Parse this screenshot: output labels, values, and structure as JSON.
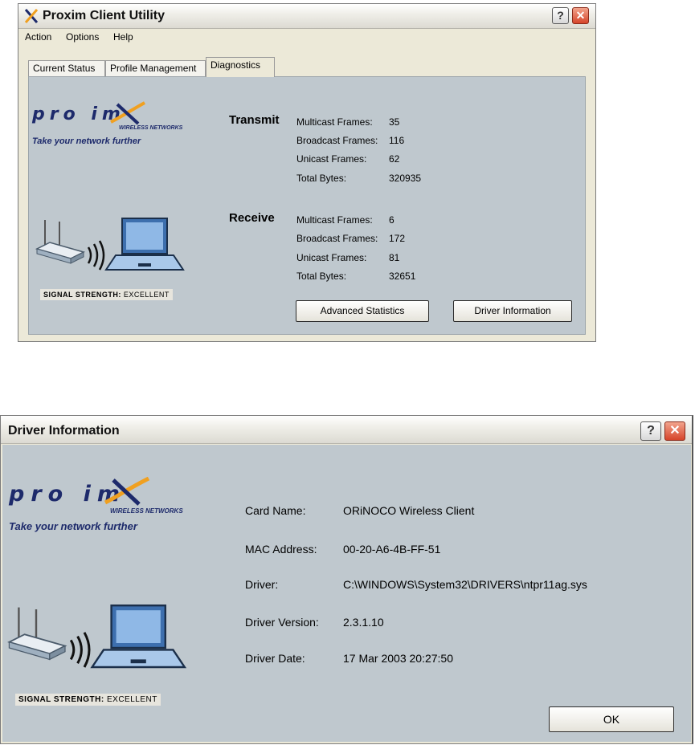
{
  "window1": {
    "title": "Proxim Client Utility",
    "help_button": "?",
    "close_button": "✕",
    "menus": [
      "Action",
      "Options",
      "Help"
    ],
    "tabs": [
      "Current Status",
      "Profile Management",
      "Diagnostics"
    ],
    "active_tab": "Diagnostics",
    "logo": {
      "word": "pro im",
      "sub": "WIRELESS NETWORKS",
      "tagline": "Take your network further"
    },
    "signal": {
      "label": "SIGNAL STRENGTH:",
      "value": "EXCELLENT"
    },
    "transmit": {
      "heading": "Transmit",
      "rows": [
        {
          "label": "Multicast Frames:",
          "value": "35"
        },
        {
          "label": "Broadcast Frames:",
          "value": "116"
        },
        {
          "label": "Unicast Frames:",
          "value": "62"
        },
        {
          "label": "Total Bytes:",
          "value": "320935"
        }
      ]
    },
    "receive": {
      "heading": "Receive",
      "rows": [
        {
          "label": "Multicast Frames:",
          "value": "6"
        },
        {
          "label": "Broadcast Frames:",
          "value": "172"
        },
        {
          "label": "Unicast Frames:",
          "value": "81"
        },
        {
          "label": "Total Bytes:",
          "value": "32651"
        }
      ]
    },
    "buttons": {
      "advanced": "Advanced Statistics",
      "driver": "Driver Information"
    }
  },
  "window2": {
    "title": "Driver Information",
    "help_button": "?",
    "close_button": "✕",
    "logo": {
      "word": "pro im",
      "sub": "WIRELESS NETWORKS",
      "tagline": "Take your network further"
    },
    "signal": {
      "label": "SIGNAL STRENGTH:",
      "value": "EXCELLENT"
    },
    "rows": [
      {
        "label": "Card Name:",
        "value": "ORiNOCO Wireless Client"
      },
      {
        "label": "MAC Address:",
        "value": "00-20-A6-4B-FF-51"
      },
      {
        "label": "Driver:",
        "value": "C:\\WINDOWS\\System32\\DRIVERS\\ntpr11ag.sys"
      },
      {
        "label": "Driver Version:",
        "value": "2.3.1.10"
      },
      {
        "label": "Driver Date:",
        "value": "17 Mar 2003 20:27:50"
      }
    ],
    "ok_button": "OK"
  },
  "icons": [
    "proxim-x-icon",
    "help-icon",
    "close-icon",
    "access-point-icon",
    "signal-waves-icon",
    "laptop-icon"
  ],
  "colors": {
    "panel": "#bfc8ce",
    "logo_blue": "#1d2a6b",
    "logo_orange": "#f0a020",
    "close_red": "#d6452a"
  }
}
